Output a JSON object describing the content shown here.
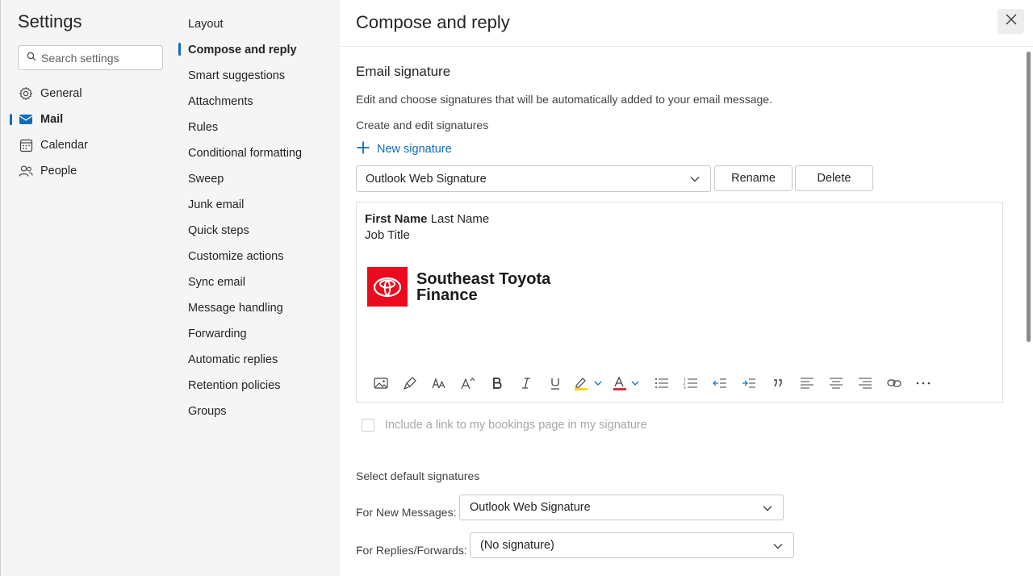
{
  "sidebar": {
    "title": "Settings",
    "search_placeholder": "Search settings",
    "items": [
      {
        "label": "General",
        "icon": "gear-icon"
      },
      {
        "label": "Mail",
        "icon": "mail-icon",
        "active": true
      },
      {
        "label": "Calendar",
        "icon": "calendar-icon"
      },
      {
        "label": "People",
        "icon": "people-icon"
      }
    ]
  },
  "subnav": {
    "items": [
      {
        "label": "Layout"
      },
      {
        "label": "Compose and reply",
        "active": true
      },
      {
        "label": "Smart suggestions"
      },
      {
        "label": "Attachments"
      },
      {
        "label": "Rules"
      },
      {
        "label": "Conditional formatting"
      },
      {
        "label": "Sweep"
      },
      {
        "label": "Junk email"
      },
      {
        "label": "Quick steps"
      },
      {
        "label": "Customize actions"
      },
      {
        "label": "Sync email"
      },
      {
        "label": "Message handling"
      },
      {
        "label": "Forwarding"
      },
      {
        "label": "Automatic replies"
      },
      {
        "label": "Retention policies"
      },
      {
        "label": "Groups"
      }
    ]
  },
  "main": {
    "title": "Compose and reply",
    "section_title": "Email signature",
    "description": "Edit and choose signatures that will be automatically added to your email message.",
    "create_label": "Create and edit signatures",
    "new_signature_label": "New signature",
    "selected_signature": "Outlook Web Signature",
    "rename_label": "Rename",
    "delete_label": "Delete",
    "signature": {
      "first_name": "First Name",
      "last_name": "Last Name",
      "job_title": "Job Title",
      "logo_line1": "Southeast Toyota",
      "logo_line2": "Finance"
    },
    "include_bookings_label": "Include a link to my bookings page in my signature",
    "include_bookings_checked": false,
    "default_signatures_label": "Select default signatures",
    "new_messages_label": "For New Messages:",
    "new_messages_value": "Outlook Web Signature",
    "replies_label": "For Replies/Forwards:",
    "replies_value": "(No signature)"
  },
  "colors": {
    "accent": "#0f6cbd",
    "logo_red": "#eb0a1e",
    "pane_bg": "#f5f5f5"
  }
}
